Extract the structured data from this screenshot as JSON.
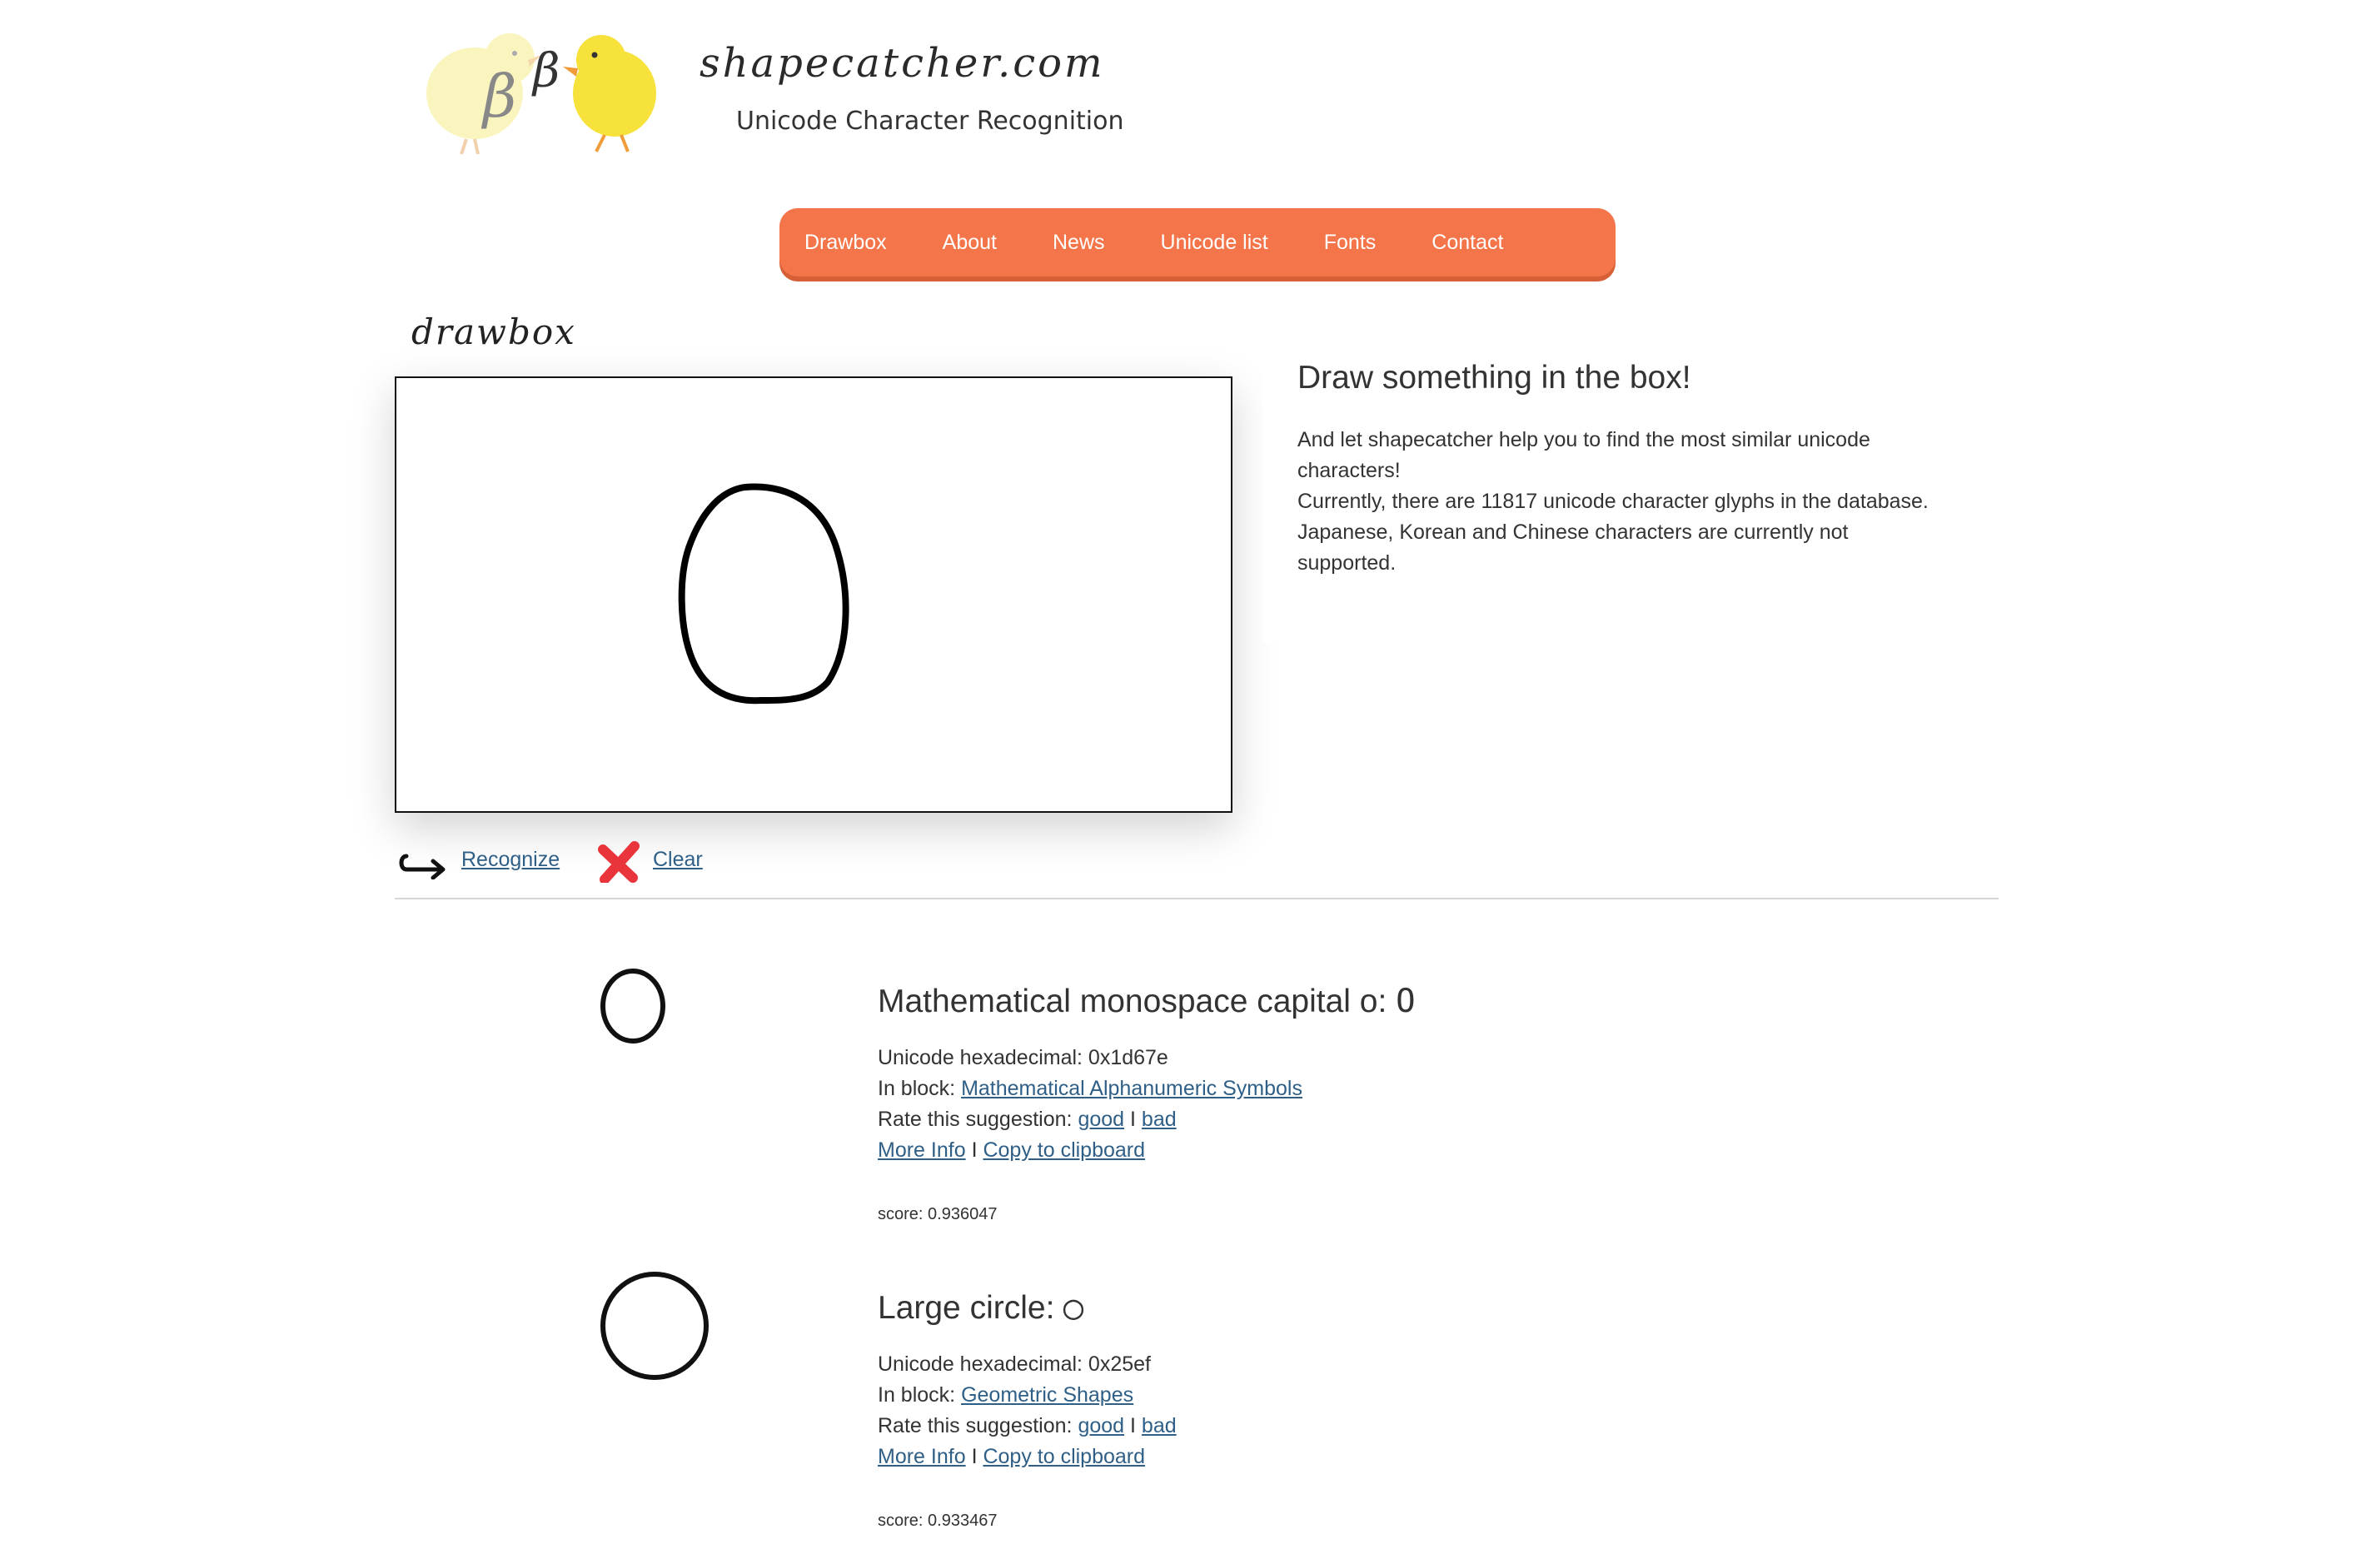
{
  "header": {
    "site_name": "shapecatcher.com",
    "tagline": "Unicode Character Recognition",
    "logo_letter_1": "β",
    "logo_letter_2": "β"
  },
  "nav": {
    "items": [
      {
        "label": "Drawbox"
      },
      {
        "label": "About"
      },
      {
        "label": "News"
      },
      {
        "label": "Unicode list"
      },
      {
        "label": "Fonts"
      },
      {
        "label": "Contact"
      }
    ]
  },
  "drawbox": {
    "title": "drawbox",
    "recognize_label": "Recognize",
    "clear_label": "Clear"
  },
  "info": {
    "heading": "Draw something in the box!",
    "lines": [
      "And let shapecatcher help you to find the most similar unicode",
      "characters!",
      "Currently, there are 11817 unicode character glyphs in the database.",
      "Japanese, Korean and Chinese characters are currently not",
      "supported."
    ]
  },
  "results": [
    {
      "name": "Mathematical monospace capital o",
      "glyph": "𝙾",
      "hex_label": "Unicode hexadecimal: 0x1d67e",
      "block_label": "In block:",
      "block": "Mathematical Alphanumeric Symbols",
      "rate_label": "Rate this suggestion:",
      "good": "good",
      "sep": "I",
      "bad": "bad",
      "more_info": "More Info",
      "copy": "Copy to clipboard",
      "score": "score: 0.936047"
    },
    {
      "name": "Large circle",
      "glyph": "◯",
      "hex_label": "Unicode hexadecimal: 0x25ef",
      "block_label": "In block:",
      "block": "Geometric Shapes",
      "rate_label": "Rate this suggestion:",
      "good": "good",
      "sep": "I",
      "bad": "bad",
      "more_info": "More Info",
      "copy": "Copy to clipboard",
      "score": "score: 0.933467"
    }
  ],
  "colors": {
    "nav_bg": "#f47549",
    "link": "#2f5f86",
    "chick_yellow": "#f6e23a"
  }
}
